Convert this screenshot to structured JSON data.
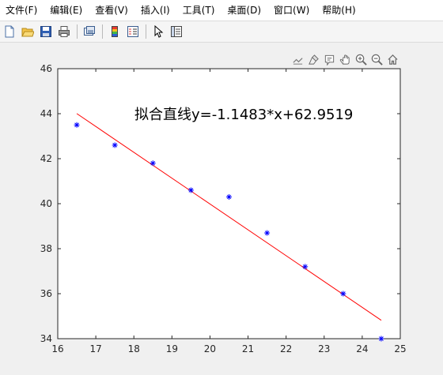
{
  "menu": {
    "items": [
      "文件(F)",
      "编辑(E)",
      "查看(V)",
      "插入(I)",
      "工具(T)",
      "桌面(D)",
      "窗口(W)",
      "帮助(H)"
    ]
  },
  "toolbar": {
    "icons": [
      "new-figure-icon",
      "open-file-icon",
      "save-icon",
      "print-icon",
      "link-plot-icon",
      "insert-colorbar-icon",
      "insert-legend-icon",
      "edit-plot-icon",
      "property-inspector-icon"
    ]
  },
  "axes_toolbar": {
    "icons": [
      "export-icon",
      "brush-icon",
      "data-tips-icon",
      "pan-icon",
      "zoom-in-icon",
      "zoom-out-icon",
      "home-icon"
    ]
  },
  "chart_data": {
    "type": "scatter",
    "title": "拟合直线y=-1.1483*x+62.9519",
    "xlabel": "",
    "ylabel": "",
    "xlim": [
      16,
      25
    ],
    "ylim": [
      34,
      46
    ],
    "xticks": [
      "16",
      "17",
      "18",
      "19",
      "20",
      "21",
      "22",
      "23",
      "24",
      "25"
    ],
    "yticks": [
      "34",
      "36",
      "38",
      "40",
      "42",
      "44",
      "46"
    ],
    "grid": false,
    "points": {
      "x": [
        16.5,
        17.5,
        18.5,
        19.5,
        20.5,
        21.5,
        22.5,
        23.5,
        24.5
      ],
      "y": [
        43.5,
        42.6,
        41.8,
        40.6,
        40.3,
        38.7,
        37.2,
        36.0,
        34.0
      ],
      "color": "#0000ff",
      "marker": "*"
    },
    "fit_line": {
      "slope": -1.1483,
      "intercept": 62.9519,
      "x_range": [
        16.5,
        24.5
      ],
      "color": "#ff0000"
    }
  }
}
